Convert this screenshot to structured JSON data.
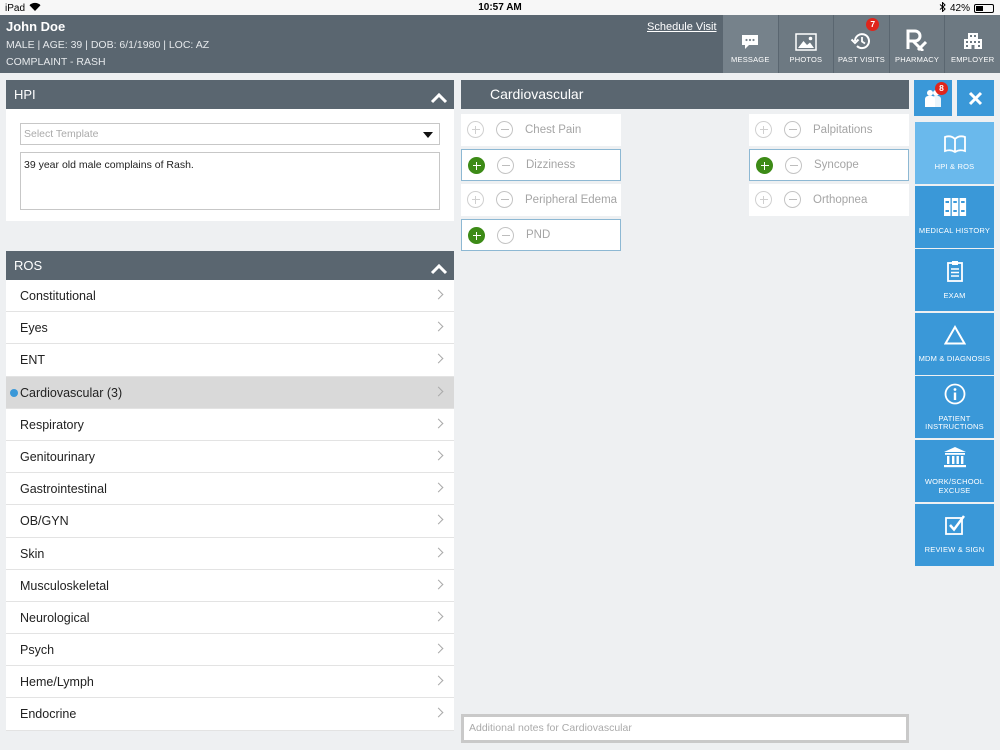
{
  "status_bar": {
    "device": "iPad",
    "time": "10:57 AM",
    "battery": "42%",
    "battery_fraction": 0.42
  },
  "patient": {
    "name": "John Doe",
    "demographics": "MALE | AGE: 39 | DOB: 6/1/1980 | LOC: AZ",
    "complaint": "COMPLAINT - RASH"
  },
  "header": {
    "schedule_link": "Schedule Visit",
    "buttons": [
      {
        "label": "MESSAGE",
        "icon": "message-icon"
      },
      {
        "label": "PHOTOS",
        "icon": "photos-icon"
      },
      {
        "label": "PAST VISITS",
        "icon": "history-icon",
        "badge": "7"
      },
      {
        "label": "PHARMACY",
        "icon": "rx-icon"
      },
      {
        "label": "EMPLOYER",
        "icon": "building-icon"
      }
    ]
  },
  "hpi": {
    "title": "HPI",
    "template_placeholder": "Select Template",
    "text": "39 year old male complains of Rash."
  },
  "ros": {
    "title": "ROS",
    "items": [
      {
        "label": "Constitutional"
      },
      {
        "label": "Eyes"
      },
      {
        "label": "ENT"
      },
      {
        "label": "Cardiovascular (3)",
        "active": true
      },
      {
        "label": "Respiratory"
      },
      {
        "label": "Genitourinary"
      },
      {
        "label": "Gastrointestinal"
      },
      {
        "label": "OB/GYN"
      },
      {
        "label": "Skin"
      },
      {
        "label": "Musculoskeletal"
      },
      {
        "label": "Neurological"
      },
      {
        "label": "Psych"
      },
      {
        "label": "Heme/Lymph"
      },
      {
        "label": "Endocrine"
      }
    ]
  },
  "cardiovascular": {
    "title": "Cardiovascular",
    "symptoms": [
      {
        "label": "Chest Pain",
        "selected": false
      },
      {
        "label": "Palpitations",
        "selected": false
      },
      {
        "label": "Dizziness",
        "selected": true
      },
      {
        "label": "Syncope",
        "selected": true
      },
      {
        "label": "Peripheral Edema",
        "selected": false
      },
      {
        "label": "Orthopnea",
        "selected": false
      },
      {
        "label": "PND",
        "selected": true
      }
    ],
    "notes_placeholder": "Additional notes for Cardiovascular"
  },
  "right_nav": {
    "people_badge": "8",
    "items": [
      {
        "label": "HPI & ROS",
        "icon": "book-icon",
        "active": true
      },
      {
        "label": "MEDICAL HISTORY",
        "icon": "binders-icon"
      },
      {
        "label": "EXAM",
        "icon": "clipboard-icon"
      },
      {
        "label": "MDM & DIAGNOSIS",
        "icon": "triangle-icon"
      },
      {
        "label": "PATIENT INSTRUCTIONS",
        "icon": "info-icon"
      },
      {
        "label": "WORK/SCHOOL EXCUSE",
        "icon": "institution-icon"
      },
      {
        "label": "REVIEW & SIGN",
        "icon": "checkbox-icon"
      }
    ]
  },
  "colors": {
    "header": "#5a6670",
    "accent": "#3a98d8",
    "active_nav": "#6ab9ec",
    "add_green": "#3d8b17",
    "badge_red": "#e0251b"
  }
}
